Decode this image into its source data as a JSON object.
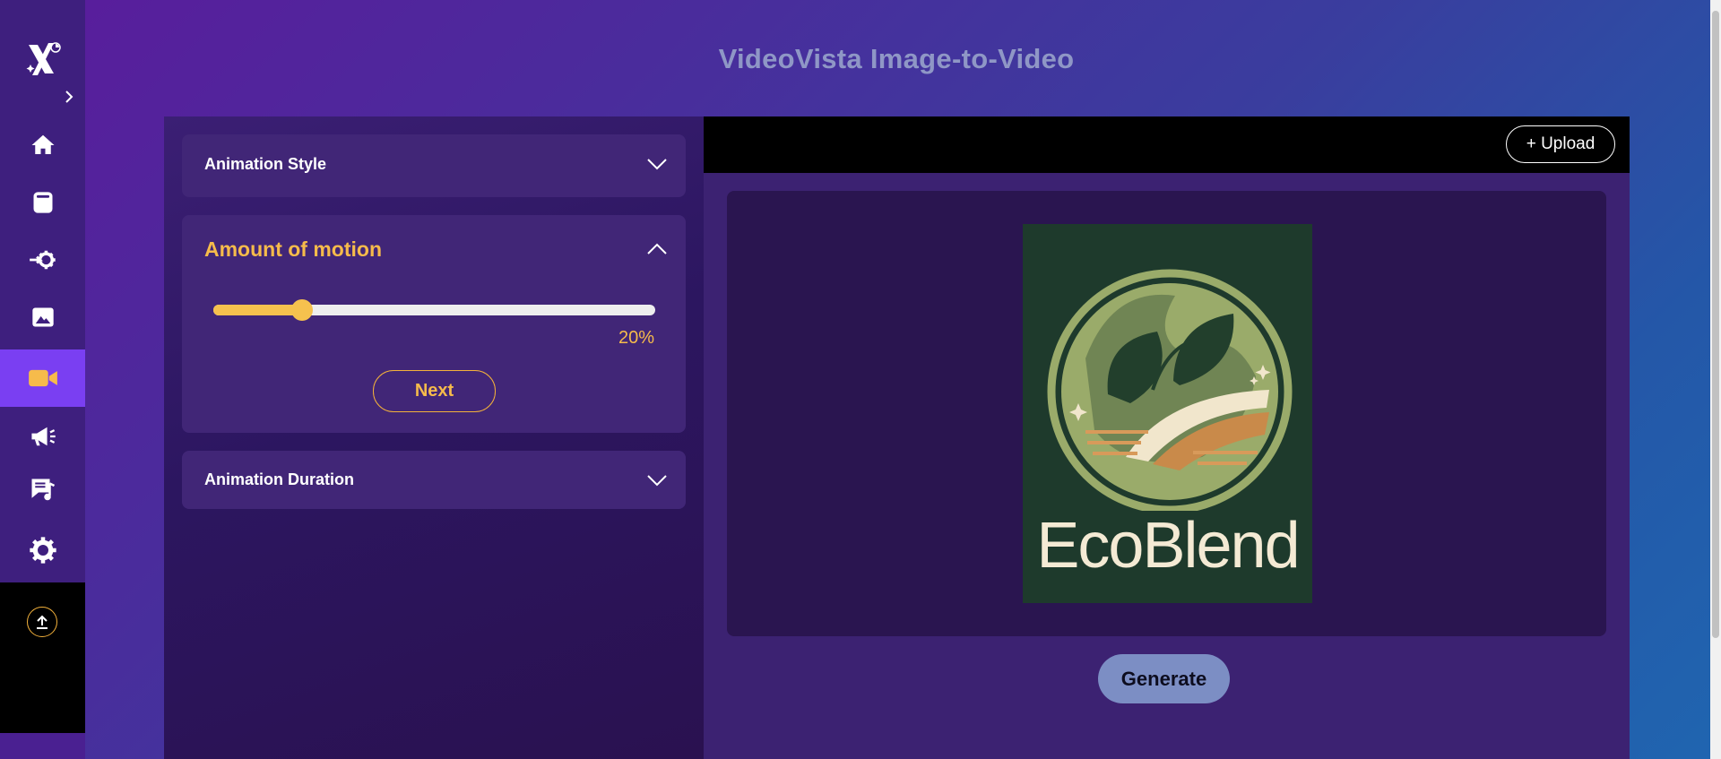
{
  "page": {
    "title": "VideoVista Image-to-Video"
  },
  "sidebar": {
    "items": [
      {
        "icon": "home-icon"
      },
      {
        "icon": "tablet-icon"
      },
      {
        "icon": "gear-arrow-icon"
      },
      {
        "icon": "image-icon"
      },
      {
        "icon": "video-camera-icon",
        "active": true
      },
      {
        "icon": "megaphone-icon"
      },
      {
        "icon": "music-note-icon"
      },
      {
        "icon": "gear-icon"
      }
    ]
  },
  "settings": {
    "animation_style": {
      "title": "Animation Style",
      "expanded": false
    },
    "amount_of_motion": {
      "title": "Amount of motion",
      "expanded": true,
      "value_percent": 20,
      "value_label": "20%",
      "next_label": "Next"
    },
    "animation_duration": {
      "title": "Animation Duration",
      "expanded": false
    }
  },
  "preview": {
    "upload_label": "+ Upload",
    "image_text": "EcoBlend",
    "generate_label": "Generate"
  },
  "colors": {
    "accent": "#f6bb4b",
    "active_nav": "#7a3ff2",
    "generate": "#7c8ec4"
  }
}
